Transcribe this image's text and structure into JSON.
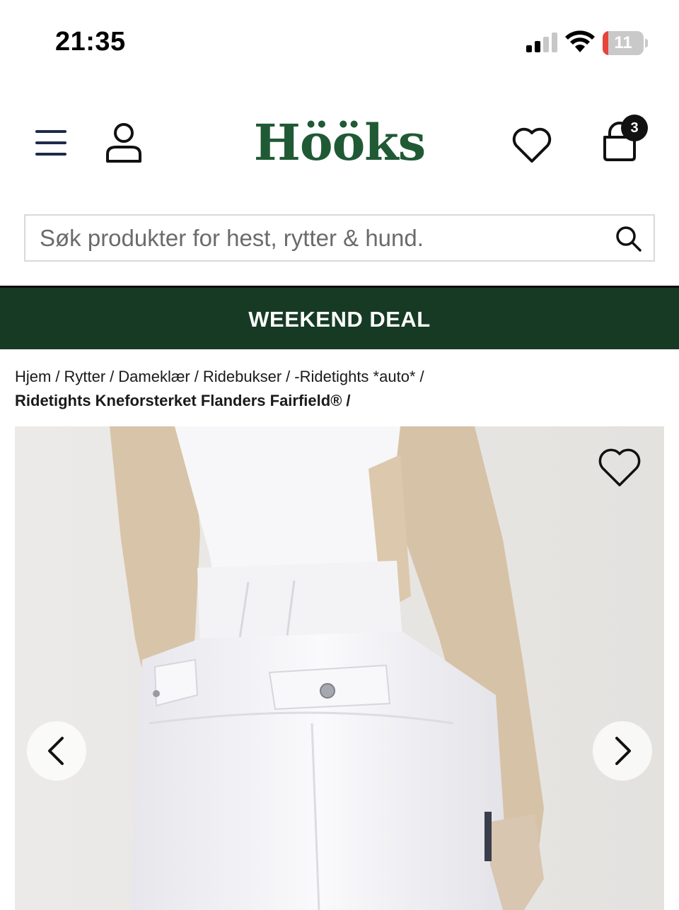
{
  "status_bar": {
    "time": "21:35",
    "battery_level": "11",
    "icons": [
      "cellular-signal-icon",
      "wifi-icon",
      "battery-icon"
    ]
  },
  "header": {
    "logo_text": "Hööks",
    "cart_count": "3",
    "icons": [
      "menu-icon",
      "account-icon",
      "heart-icon",
      "shopping-bag-icon"
    ],
    "brand_color": "#1f5a35"
  },
  "search": {
    "placeholder": "Søk produkter for hest, rytter & hund.",
    "value": ""
  },
  "promo": {
    "text": "WEEKEND DEAL",
    "background_color": "#173a24"
  },
  "breadcrumb": {
    "items": [
      "Hjem",
      "Rytter",
      "Dameklær",
      "Ridebukser",
      "-Ridetights *auto*"
    ],
    "separator": "/",
    "current": "Ridetights Kneforsterket Flanders Fairfield®"
  },
  "product_gallery": {
    "icons": [
      "heart-icon",
      "chevron-left-icon",
      "chevron-right-icon"
    ]
  }
}
